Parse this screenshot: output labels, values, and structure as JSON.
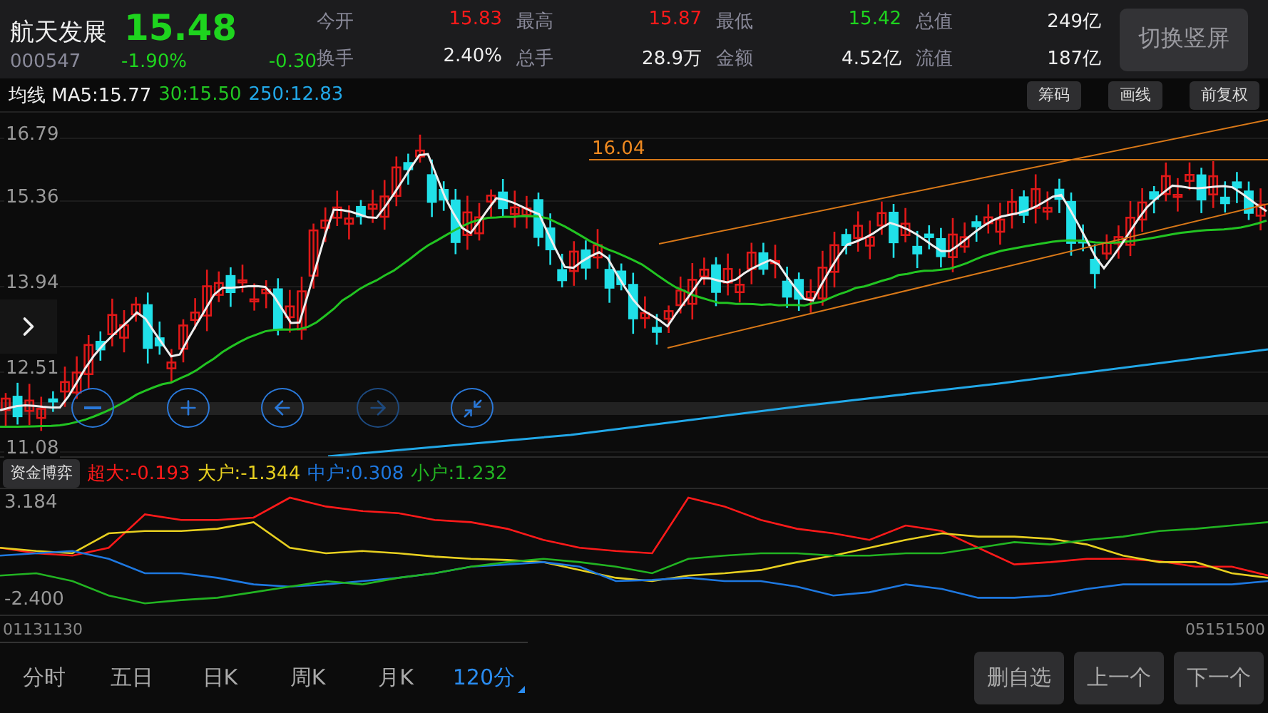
{
  "stock": {
    "name": "航天发展",
    "price": "15.48",
    "code": "000547",
    "change_pct": "-1.90%",
    "change": "-0.30"
  },
  "quote_rows": [
    [
      {
        "label": "今开",
        "value": "15.83",
        "color": "#ff1a1a"
      },
      {
        "label": "最高",
        "value": "15.87",
        "color": "#ff1a1a"
      },
      {
        "label": "最低",
        "value": "15.42",
        "color": "#1ed41e"
      },
      {
        "label": "总值",
        "value": "249亿",
        "color": "#eeeeee"
      }
    ],
    [
      {
        "label": "换手",
        "value": "2.40%",
        "color": "#eeeeee"
      },
      {
        "label": "总手",
        "value": "28.9万",
        "color": "#eeeeee"
      },
      {
        "label": "金额",
        "value": "4.52亿",
        "color": "#eeeeee"
      },
      {
        "label": "流值",
        "value": "187亿",
        "color": "#eeeeee"
      }
    ]
  ],
  "orientation_button": "切换竖屏",
  "ma_legend": [
    {
      "label": "均线 MA5:15.77",
      "color": "#eeeeee"
    },
    {
      "label": "30:15.50",
      "color": "#22c422"
    },
    {
      "label": "250:12.83",
      "color": "#22a8e8"
    }
  ],
  "chart_buttons": [
    "筹码",
    "画线",
    "前复权"
  ],
  "price_axis": [
    "16.79",
    "15.36",
    "13.94",
    "12.51",
    "11.08"
  ],
  "price_line_label": "16.04",
  "zoom_controls": [
    {
      "kind": "zoom-out",
      "disabled": false
    },
    {
      "kind": "zoom-in",
      "disabled": false
    },
    {
      "kind": "back",
      "disabled": false
    },
    {
      "kind": "forward",
      "disabled": true
    },
    {
      "kind": "shrink",
      "disabled": false
    }
  ],
  "indicator": {
    "button": "资金博弈",
    "legend": [
      {
        "label": "超大:-0.193",
        "color": "#ff1a1a"
      },
      {
        "label": "大户:-1.344",
        "color": "#e8d020"
      },
      {
        "label": "中户:0.308",
        "color": "#1e78e0"
      },
      {
        "label": "小户:1.232",
        "color": "#22b422"
      }
    ],
    "axis": [
      "3.184",
      "-2.400"
    ]
  },
  "time_axis": [
    "01131130",
    "05151500"
  ],
  "period_tabs": [
    {
      "label": "分时",
      "selected": false
    },
    {
      "label": "五日",
      "selected": false
    },
    {
      "label": "日K",
      "selected": false
    },
    {
      "label": "周K",
      "selected": false
    },
    {
      "label": "月K",
      "selected": false
    },
    {
      "label": "120分",
      "selected": true
    }
  ],
  "actions": [
    "删自选",
    "上一个",
    "下一个"
  ]
}
